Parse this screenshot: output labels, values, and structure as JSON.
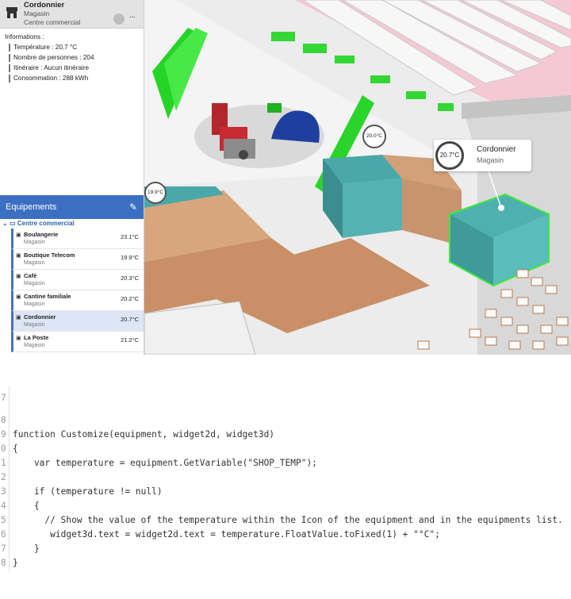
{
  "info_panel": {
    "title": "Cordonnier",
    "subtitle": "Magasin",
    "location": "Centre commercial",
    "more_label": "···",
    "section_label": "Informations :",
    "rows": [
      "Température : 20,7 °C",
      "Nombre de personnes : 204",
      "Itinéraire : Aucun itinéraire",
      "Consommation : 288 kWh"
    ]
  },
  "equipments": {
    "title": "Equipements",
    "root_label": "Centre commercial",
    "items": [
      {
        "name": "Boulangerie",
        "type": "Magasin",
        "temp": "23.1°C"
      },
      {
        "name": "Boutique Telecom",
        "type": "Magasin",
        "temp": "19.9°C"
      },
      {
        "name": "Café",
        "type": "Magasin",
        "temp": "20.3°C"
      },
      {
        "name": "Cantine familiale",
        "type": "Magasin",
        "temp": "20.2°C"
      },
      {
        "name": "Cordonnier",
        "type": "Magasin",
        "temp": "20.7°C"
      },
      {
        "name": "La Poste",
        "type": "Magasin",
        "temp": "21.2°C"
      }
    ]
  },
  "scene": {
    "badge_small_1": "20.0°C",
    "badge_small_2": "19.9°C",
    "badge_main": "20.7°C",
    "callout_title": "Cordonnier",
    "callout_subtitle": "Magasin"
  },
  "code": {
    "lines": [
      {
        "num": "7",
        "text": ""
      },
      {
        "num": "8",
        "text": "function Customize(equipment, widget2d, widget3d)"
      },
      {
        "num": "9",
        "text": "{"
      },
      {
        "num": "0",
        "text": "    var temperature = equipment.GetVariable(\"SHOP_TEMP\");"
      },
      {
        "num": "1",
        "text": ""
      },
      {
        "num": "2",
        "text": "    if (temperature != null)"
      },
      {
        "num": "3",
        "text": "    {"
      },
      {
        "num": "4",
        "text": "      // Show the value of the temperature within the Icon of the equipment and in the equipments list."
      },
      {
        "num": "5",
        "text": "       widget3d.text = widget2d.text = temperature.FloatValue.toFixed(1) + \"°C\";"
      },
      {
        "num": "6",
        "text": "    }"
      },
      {
        "num": "7",
        "text": "}"
      },
      {
        "num": "8",
        "text": ""
      }
    ]
  }
}
